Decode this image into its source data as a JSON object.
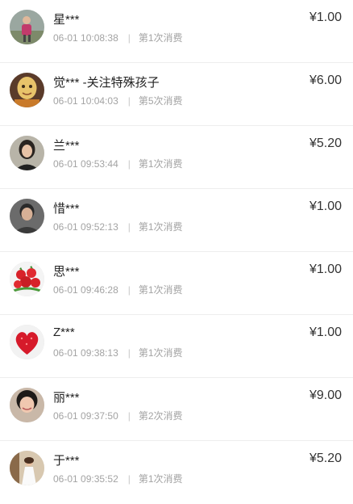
{
  "donations": [
    {
      "name": "星***",
      "time": "06-01 10:08:38",
      "count": "第1次消费",
      "amount": "¥1.00",
      "avatar_icon": "person-outdoor-avatar-icon"
    },
    {
      "name": "觉*** -关注特殊孩子",
      "time": "06-01 10:04:03",
      "count": "第5次消费",
      "amount": "¥6.00",
      "avatar_icon": "cartoon-face-avatar-icon"
    },
    {
      "name": "兰***",
      "time": "06-01 09:53:44",
      "count": "第1次消费",
      "amount": "¥5.20",
      "avatar_icon": "woman-portrait-avatar-icon"
    },
    {
      "name": "惜***",
      "time": "06-01 09:52:13",
      "count": "第1次消费",
      "amount": "¥1.00",
      "avatar_icon": "man-portrait-avatar-icon"
    },
    {
      "name": "思***",
      "time": "06-01 09:46:28",
      "count": "第1次消费",
      "amount": "¥1.00",
      "avatar_icon": "strawberries-avatar-icon"
    },
    {
      "name": "Z***",
      "time": "06-01 09:38:13",
      "count": "第1次消费",
      "amount": "¥1.00",
      "avatar_icon": "heart-avatar-icon"
    },
    {
      "name": "丽***",
      "time": "06-01 09:37:50",
      "count": "第2次消费",
      "amount": "¥9.00",
      "avatar_icon": "smiling-woman-avatar-icon"
    },
    {
      "name": "于***",
      "time": "06-01 09:35:52",
      "count": "第1次消费",
      "amount": "¥5.20",
      "avatar_icon": "bride-avatar-icon"
    }
  ]
}
